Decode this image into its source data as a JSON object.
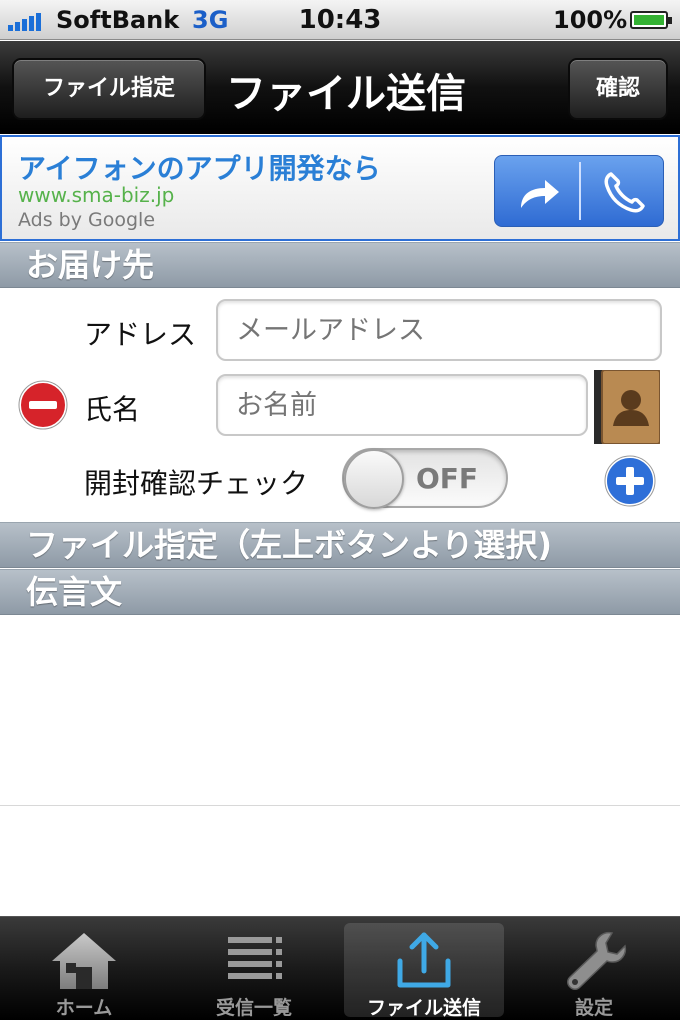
{
  "status_bar": {
    "carrier": "SoftBank",
    "network": "3G",
    "time": "10:43",
    "battery": "100%"
  },
  "nav": {
    "left_button": "ファイル指定",
    "title": "ファイル送信",
    "right_button": "確認"
  },
  "ad": {
    "title": "アイフォンのアプリ開発なら",
    "url": "www.sma-biz.jp",
    "by": "Ads by Google"
  },
  "sections": {
    "recipient": "お届け先",
    "file": "ファイル指定（左上ボタンより選択)",
    "message": "伝言文"
  },
  "form": {
    "address_label": "アドレス",
    "address_placeholder": "メールアドレス",
    "name_label": "氏名",
    "name_placeholder": "お名前",
    "read_check_label": "開封確認チェック",
    "read_check_state": "OFF"
  },
  "tabs": [
    {
      "label": "ホーム",
      "icon": "home-icon"
    },
    {
      "label": "受信一覧",
      "icon": "list-icon"
    },
    {
      "label": "ファイル送信",
      "icon": "upload-icon"
    },
    {
      "label": "設定",
      "icon": "wrench-icon"
    }
  ],
  "colors": {
    "accent": "#2a7fd6",
    "section": "#9ba6b1",
    "tab_active": "#3fa9e6"
  }
}
